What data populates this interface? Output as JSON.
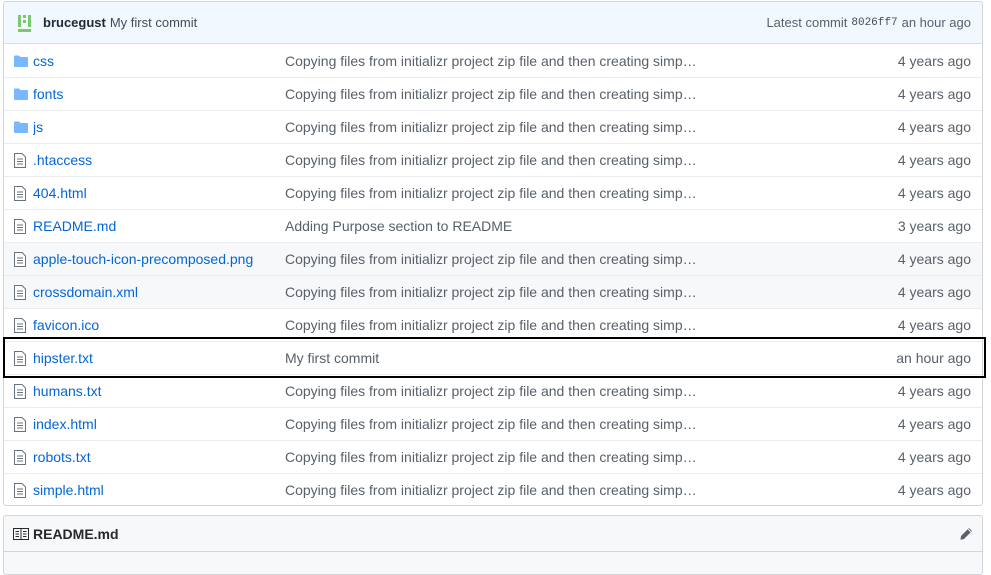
{
  "commit": {
    "author": "brucegust",
    "message": "My first commit",
    "latest_label": "Latest commit",
    "sha": "8026ff7",
    "age": "an hour ago"
  },
  "files": [
    {
      "type": "folder",
      "name": "css",
      "message": "Copying files from initializr project zip file and then creating simp…",
      "age": "4 years ago"
    },
    {
      "type": "folder",
      "name": "fonts",
      "message": "Copying files from initializr project zip file and then creating simp…",
      "age": "4 years ago"
    },
    {
      "type": "folder",
      "name": "js",
      "message": "Copying files from initializr project zip file and then creating simp…",
      "age": "4 years ago"
    },
    {
      "type": "file",
      "name": ".htaccess",
      "message": "Copying files from initializr project zip file and then creating simp…",
      "age": "4 years ago"
    },
    {
      "type": "file",
      "name": "404.html",
      "message": "Copying files from initializr project zip file and then creating simp…",
      "age": "4 years ago"
    },
    {
      "type": "file",
      "name": "README.md",
      "message": "Adding Purpose section to README",
      "age": "3 years ago"
    },
    {
      "type": "file",
      "name": "apple-touch-icon-precomposed.png",
      "message": "Copying files from initializr project zip file and then creating simp…",
      "age": "4 years ago"
    },
    {
      "type": "file",
      "name": "crossdomain.xml",
      "message": "Copying files from initializr project zip file and then creating simp…",
      "age": "4 years ago"
    },
    {
      "type": "file",
      "name": "favicon.ico",
      "message": "Copying files from initializr project zip file and then creating simp…",
      "age": "4 years ago"
    },
    {
      "type": "file",
      "name": "hipster.txt",
      "message": "My first commit",
      "age": "an hour ago"
    },
    {
      "type": "file",
      "name": "humans.txt",
      "message": "Copying files from initializr project zip file and then creating simp…",
      "age": "4 years ago"
    },
    {
      "type": "file",
      "name": "index.html",
      "message": "Copying files from initializr project zip file and then creating simp…",
      "age": "4 years ago"
    },
    {
      "type": "file",
      "name": "robots.txt",
      "message": "Copying files from initializr project zip file and then creating simp…",
      "age": "4 years ago"
    },
    {
      "type": "file",
      "name": "simple.html",
      "message": "Copying files from initializr project zip file and then creating simp…",
      "age": "4 years ago"
    }
  ],
  "readme": {
    "title": "README.md",
    "book_icon": "book-icon",
    "edit_icon": "pencil-icon"
  },
  "colors": {
    "link": "#0366d6",
    "folder_icon": "#79b8ff",
    "commit_bar_bg": "#f1f8ff",
    "highlight_border": "#000000"
  }
}
